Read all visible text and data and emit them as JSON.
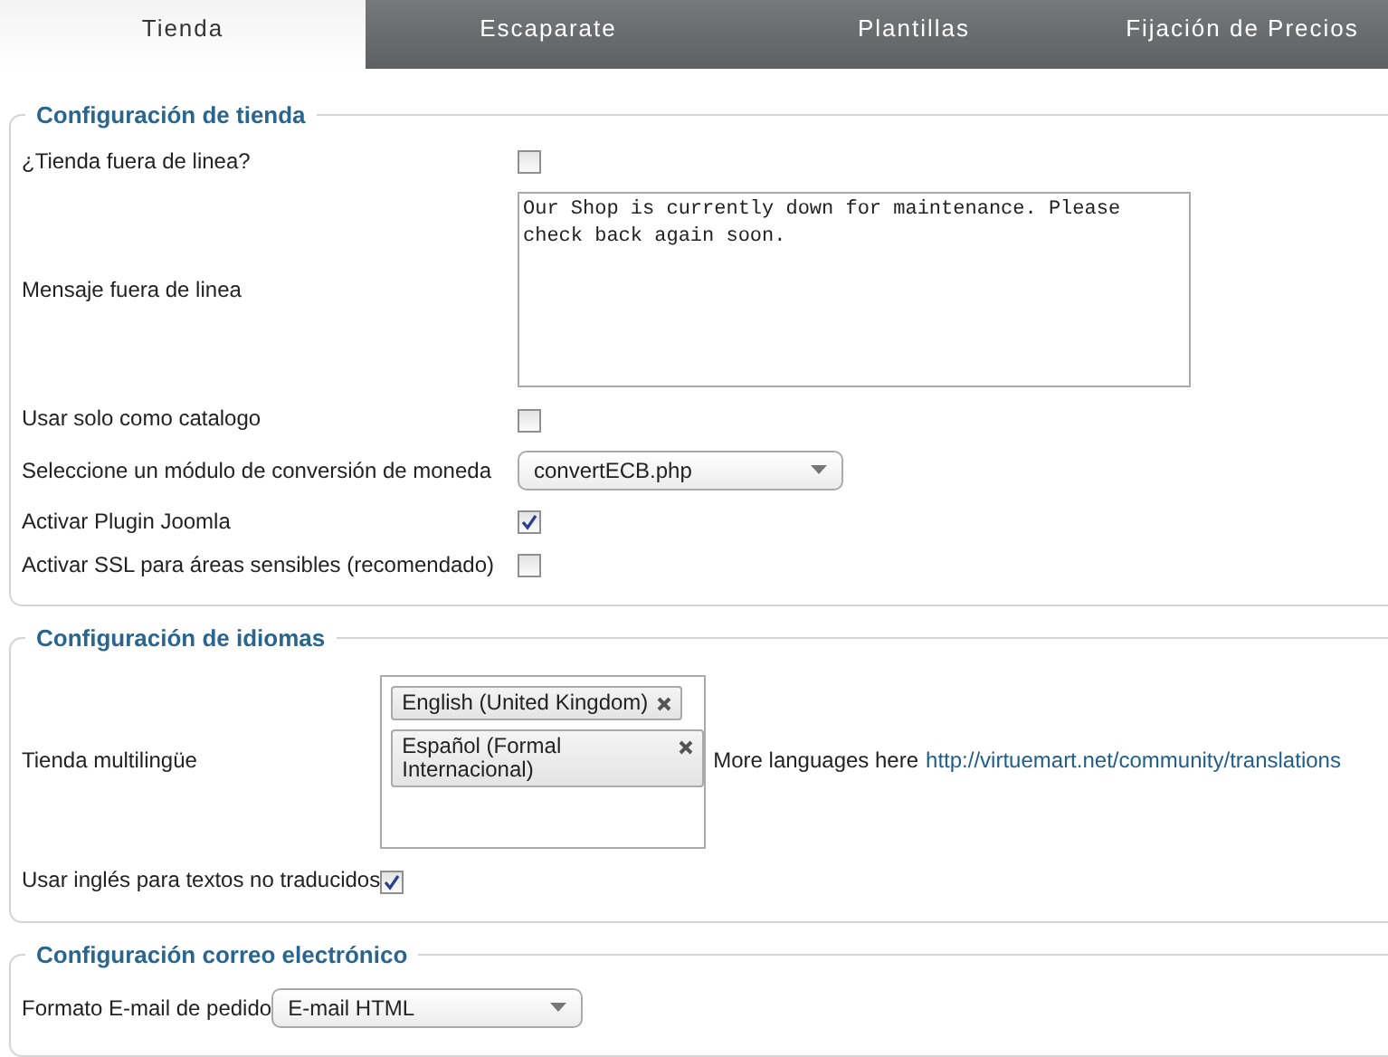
{
  "tabs": [
    {
      "label": "Tienda",
      "selected": true
    },
    {
      "label": "Escaparate",
      "selected": false
    },
    {
      "label": "Plantillas",
      "selected": false
    },
    {
      "label": "Fijación de Precios",
      "selected": false
    }
  ],
  "sections": [
    {
      "title": "Configuración de tienda",
      "rows": [
        {
          "kind": "checkbox",
          "label": "¿Tienda fuera de linea?",
          "checked": false
        },
        {
          "kind": "textarea",
          "label": "Mensaje fuera de linea",
          "value": "Our Shop is currently down for maintenance. Please check back again soon."
        },
        {
          "kind": "checkbox",
          "label": "Usar solo como catalogo",
          "checked": false
        },
        {
          "kind": "select",
          "label": "Seleccione un módulo de conversión de moneda",
          "value": "convertECB.php"
        },
        {
          "kind": "checkbox",
          "label": "Activar Plugin Joomla",
          "checked": true
        },
        {
          "kind": "checkbox",
          "label": "Activar SSL para áreas sensibles (recomendado)",
          "checked": false
        }
      ]
    },
    {
      "title": "Configuración de idiomas",
      "rows": [
        {
          "kind": "multiselect",
          "label": "Tienda multilingüe",
          "chips": [
            "English (United Kingdom)",
            "Español (Formal Internacional)"
          ],
          "note": "More languages here",
          "link": "http://virtuemart.net/community/translations"
        },
        {
          "kind": "checkbox",
          "label": "Usar inglés para textos no traducidos",
          "checked": true
        }
      ]
    },
    {
      "title": "Configuración correo electrónico",
      "rows": [
        {
          "kind": "select",
          "label": "Formato E-mail de pedido",
          "value": "E-mail HTML"
        }
      ]
    }
  ]
}
